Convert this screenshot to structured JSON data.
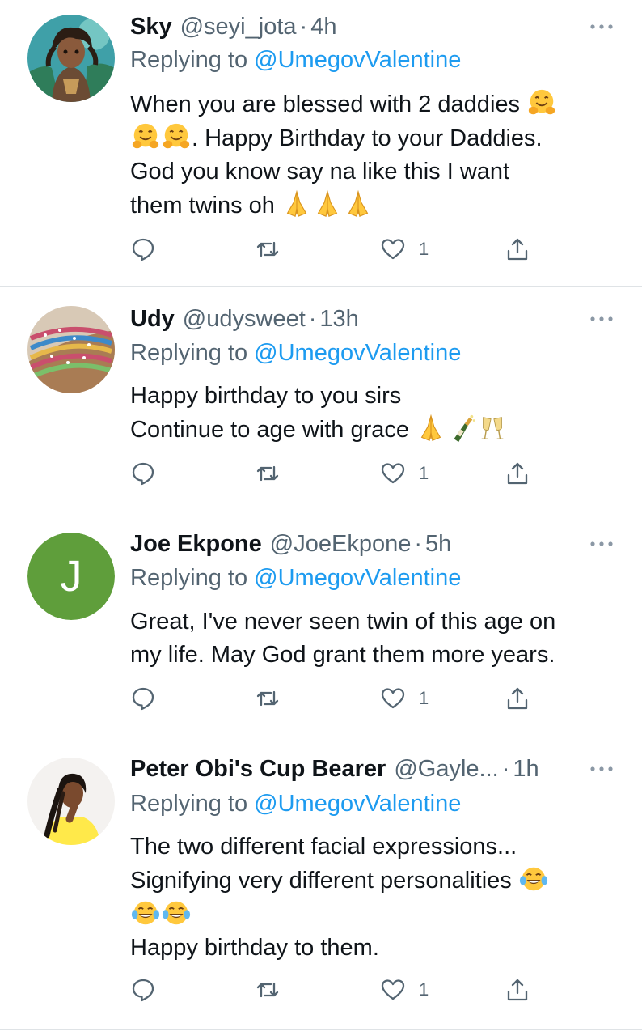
{
  "tweets": [
    {
      "name": "Sky",
      "handle": "@seyi_jota",
      "time": "4h",
      "replying_prefix": "Replying to ",
      "replying_to": "@UmegovValentine",
      "lines": [
        "When you are blessed with 2 daddies",
        ". Happy Birthday to your Daddies.",
        " God you know say na like this I want",
        "them twins oh"
      ],
      "emoji": [
        "hugging-face",
        "folded-hands"
      ],
      "reply_count": "",
      "retweet_count": "",
      "like_count": "1"
    },
    {
      "name": "Udy",
      "handle": "@udysweet",
      "time": "13h",
      "replying_prefix": "Replying to ",
      "replying_to": "@UmegovValentine",
      "lines": [
        "Happy birthday to you sirs",
        "Continue to age with grace"
      ],
      "emoji": [
        "folded-hands",
        "champagne-bottle",
        "clinking-glasses"
      ],
      "reply_count": "",
      "retweet_count": "",
      "like_count": "1"
    },
    {
      "name": "Joe Ekpone",
      "handle": "@JoeEkpone",
      "time": "5h",
      "avatar_letter": "J",
      "replying_prefix": "Replying to ",
      "replying_to": "@UmegovValentine",
      "lines": [
        "Great, I've never seen twin of this age on",
        "my life. May God grant them more years."
      ],
      "reply_count": "",
      "retweet_count": "",
      "like_count": "1"
    },
    {
      "name": "Peter Obi's Cup Bearer",
      "handle": "@Gayle...",
      "time": "1h",
      "replying_prefix": "Replying to ",
      "replying_to": "@UmegovValentine",
      "lines": [
        "The two different facial expressions...",
        "Signifying very different personalities",
        "",
        "Happy birthday to them."
      ],
      "emoji": [
        "face-with-tears-of-joy"
      ],
      "reply_count": "",
      "retweet_count": "",
      "like_count": "1"
    }
  ],
  "colors": {
    "primary_text": "#0f1419",
    "secondary_text": "#536471",
    "link": "#1d9bf0",
    "divider": "#dfe3e6",
    "avatar_j_bg": "#5f9e3b"
  },
  "icons": [
    "more-icon",
    "reply-icon",
    "retweet-icon",
    "like-icon",
    "share-icon"
  ],
  "separator": "·"
}
